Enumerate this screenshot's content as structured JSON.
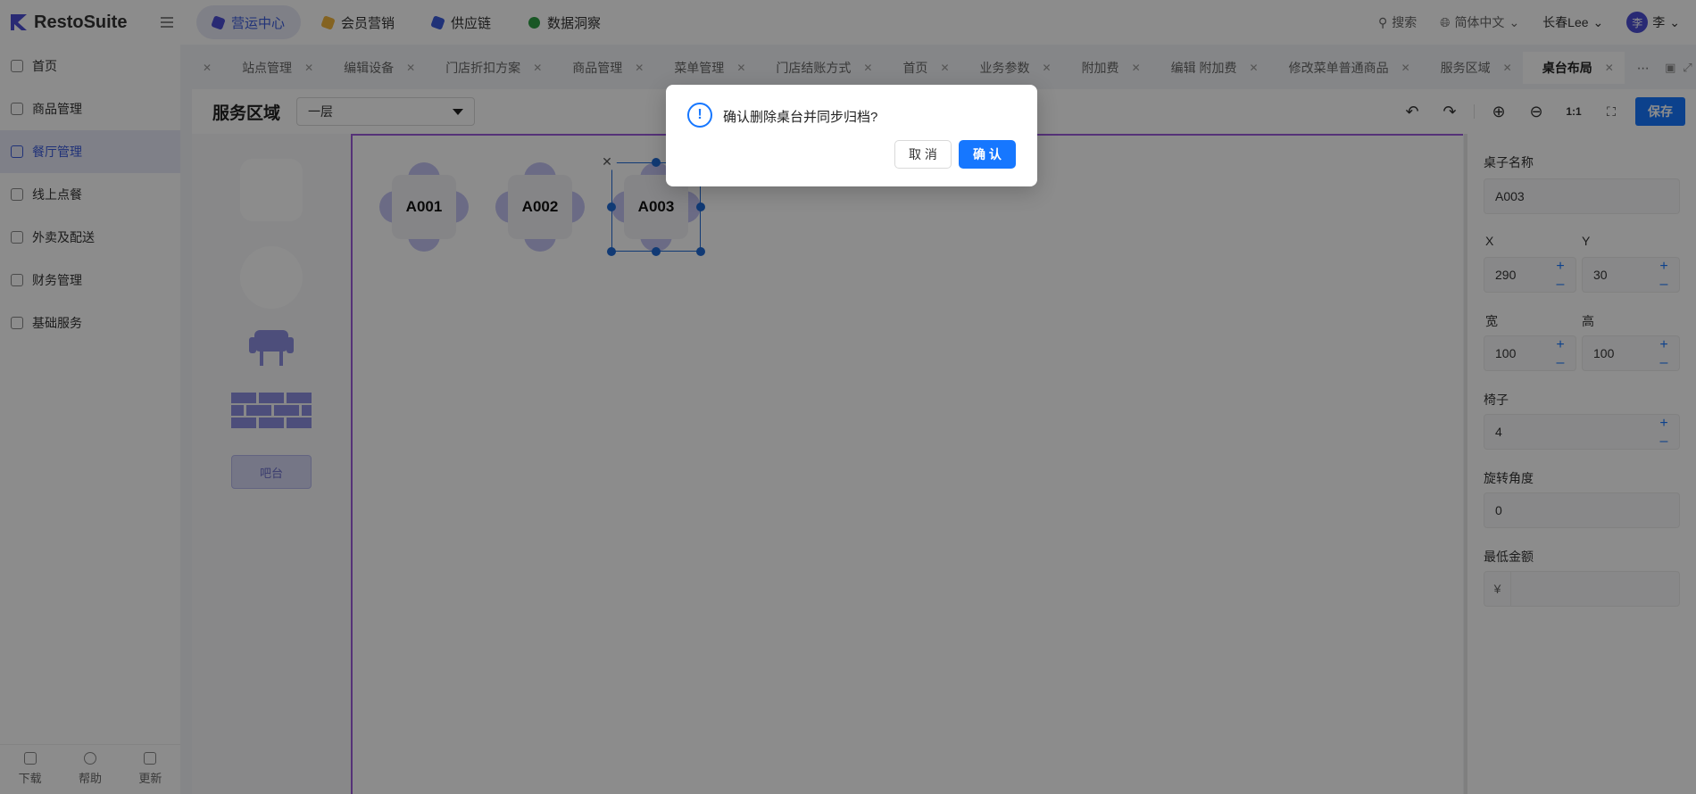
{
  "brand": {
    "name": "RestoSuite",
    "color": "#4c4ed4"
  },
  "topnav": [
    {
      "label": "营运中心",
      "active": true,
      "color": "#4c4ed4"
    },
    {
      "label": "会员营销",
      "active": false,
      "color": "#f0b43c"
    },
    {
      "label": "供应链",
      "active": false,
      "color": "#3b5bdb"
    },
    {
      "label": "数据洞察",
      "active": false,
      "color": "#2f9e44"
    }
  ],
  "topright": {
    "search": "搜索",
    "language": "简体中文",
    "store": "长春Lee",
    "avatar_char": "李",
    "user": "李"
  },
  "sidebar": {
    "items": [
      {
        "label": "首页",
        "icon": "home-icon"
      },
      {
        "label": "商品管理",
        "icon": "box-icon"
      },
      {
        "label": "餐厅管理",
        "icon": "store-icon",
        "active": true
      },
      {
        "label": "线上点餐",
        "icon": "hand-icon"
      },
      {
        "label": "外卖及配送",
        "icon": "bag-icon"
      },
      {
        "label": "财务管理",
        "icon": "folder-icon"
      },
      {
        "label": "基础服务",
        "icon": "grid-icon"
      }
    ],
    "bottom": [
      {
        "label": "下载",
        "icon": "download-icon"
      },
      {
        "label": "帮助",
        "icon": "help-icon"
      },
      {
        "label": "更新",
        "icon": "update-icon"
      }
    ]
  },
  "tabs": [
    {
      "label": "站点管理"
    },
    {
      "label": "编辑设备"
    },
    {
      "label": "门店折扣方案"
    },
    {
      "label": "商品管理"
    },
    {
      "label": "菜单管理"
    },
    {
      "label": "门店结账方式"
    },
    {
      "label": "首页"
    },
    {
      "label": "业务参数"
    },
    {
      "label": "附加费"
    },
    {
      "label": "编辑 附加费"
    },
    {
      "label": "修改菜单普通商品"
    },
    {
      "label": "服务区域"
    },
    {
      "label": "桌台布局",
      "active": true
    }
  ],
  "toolbar": {
    "title": "服务区域",
    "floor": "一层",
    "zoom_reset": "1:1",
    "save": "保存"
  },
  "palette": {
    "bar_label": "吧台"
  },
  "canvas": {
    "tables": [
      {
        "name": "A001",
        "selected": false
      },
      {
        "name": "A002",
        "selected": false
      },
      {
        "name": "A003",
        "selected": true
      }
    ]
  },
  "properties": {
    "name_label": "桌子名称",
    "name_value": "A003",
    "x_label": "X",
    "x_value": "290",
    "y_label": "Y",
    "y_value": "30",
    "w_label": "宽",
    "w_value": "100",
    "h_label": "高",
    "h_value": "100",
    "chairs_label": "椅子",
    "chairs_value": "4",
    "rotation_label": "旋转角度",
    "rotation_value": "0",
    "min_amount_label": "最低金额",
    "currency": "¥",
    "min_amount_value": ""
  },
  "dialog": {
    "message": "确认删除桌台并同步归档?",
    "cancel": "取 消",
    "ok": "确 认",
    "icon": "exclamation-icon"
  }
}
